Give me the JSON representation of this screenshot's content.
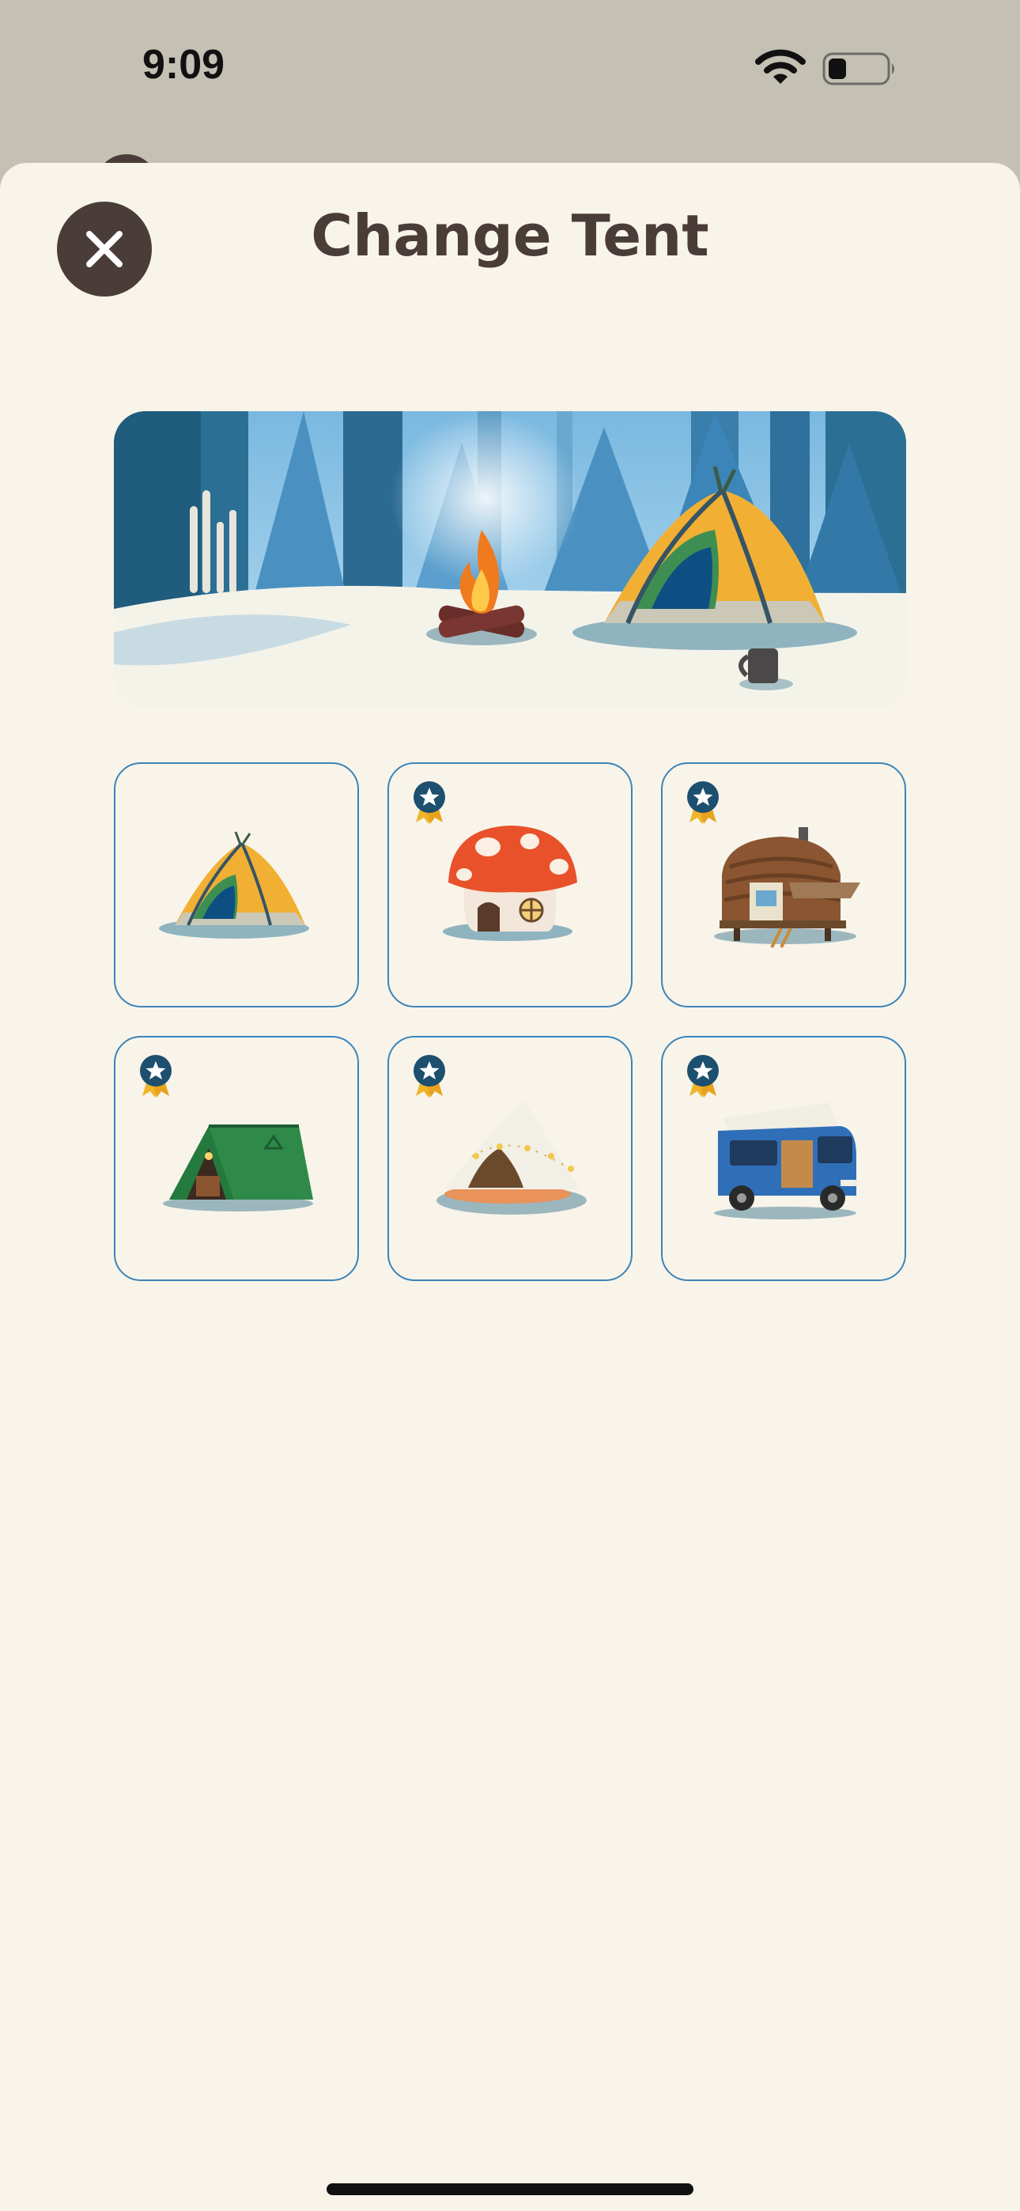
{
  "status_bar": {
    "time": "9:09",
    "wifi_icon": "wifi-icon",
    "battery_icon": "battery-icon",
    "battery_level": 0.3
  },
  "sheet": {
    "title": "Change Tent",
    "close_icon": "close-icon",
    "preview_scene": "campsite-preview",
    "tents": [
      {
        "name": "dome-tent",
        "locked": false
      },
      {
        "name": "mushroom-house",
        "locked": true,
        "badge_icon": "star-medal-icon"
      },
      {
        "name": "wooden-cabin",
        "locked": true,
        "badge_icon": "star-medal-icon"
      },
      {
        "name": "green-a-frame-tent",
        "locked": true,
        "badge_icon": "star-medal-icon"
      },
      {
        "name": "bell-tent",
        "locked": true,
        "badge_icon": "star-medal-icon"
      },
      {
        "name": "camper-van",
        "locked": true,
        "badge_icon": "star-medal-icon"
      }
    ]
  },
  "colors": {
    "sheet_background": "#f8f4e9",
    "title_color": "#4a3c38",
    "tile_border": "#3b84b9",
    "status_bar_background": "#c4c0b4"
  }
}
